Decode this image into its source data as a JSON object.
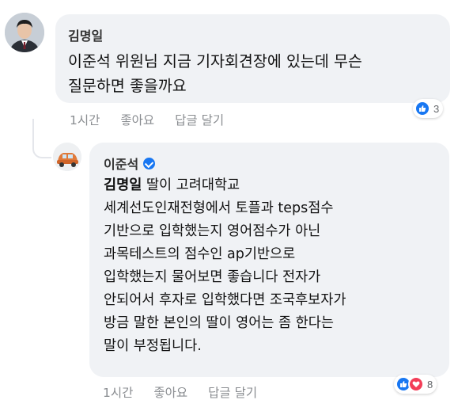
{
  "colors": {
    "bubble": "#f0f2f5",
    "meta_text": "#8a8d91",
    "like_blue": "#1877f2",
    "love_red": "#f33e58",
    "verified_blue": "#1877f2"
  },
  "comment1": {
    "author": "김명일",
    "lines": [
      "이준석 위원님 지금 기자회견장에 있는데 무슨",
      "질문하면 좋을까요"
    ],
    "time": "1시간",
    "like_label": "좋아요",
    "reply_label": "답글 달기",
    "reactions": {
      "icons": [
        "like-icon"
      ],
      "count": "3"
    }
  },
  "comment2": {
    "author": "이준석",
    "verified": true,
    "mention": "김명일",
    "first_line_rest": " 딸이 고려대학교",
    "lines": [
      "세계선도인재전형에서 토플과 teps점수",
      "기반으로 입학했는지 영어점수가 아닌",
      "과목테스트의 점수인 ap기반으로",
      "입학했는지 물어보면 좋습니다 전자가",
      "안되어서 후자로 입학했다면 조국후보자가",
      "방금 말한 본인의 딸이 영어는 좀 한다는",
      "말이 부정됩니다."
    ],
    "time": "1시간",
    "like_label": "좋아요",
    "reply_label": "답글 달기",
    "reactions": {
      "icons": [
        "like-icon",
        "love-icon"
      ],
      "count": "8"
    }
  }
}
